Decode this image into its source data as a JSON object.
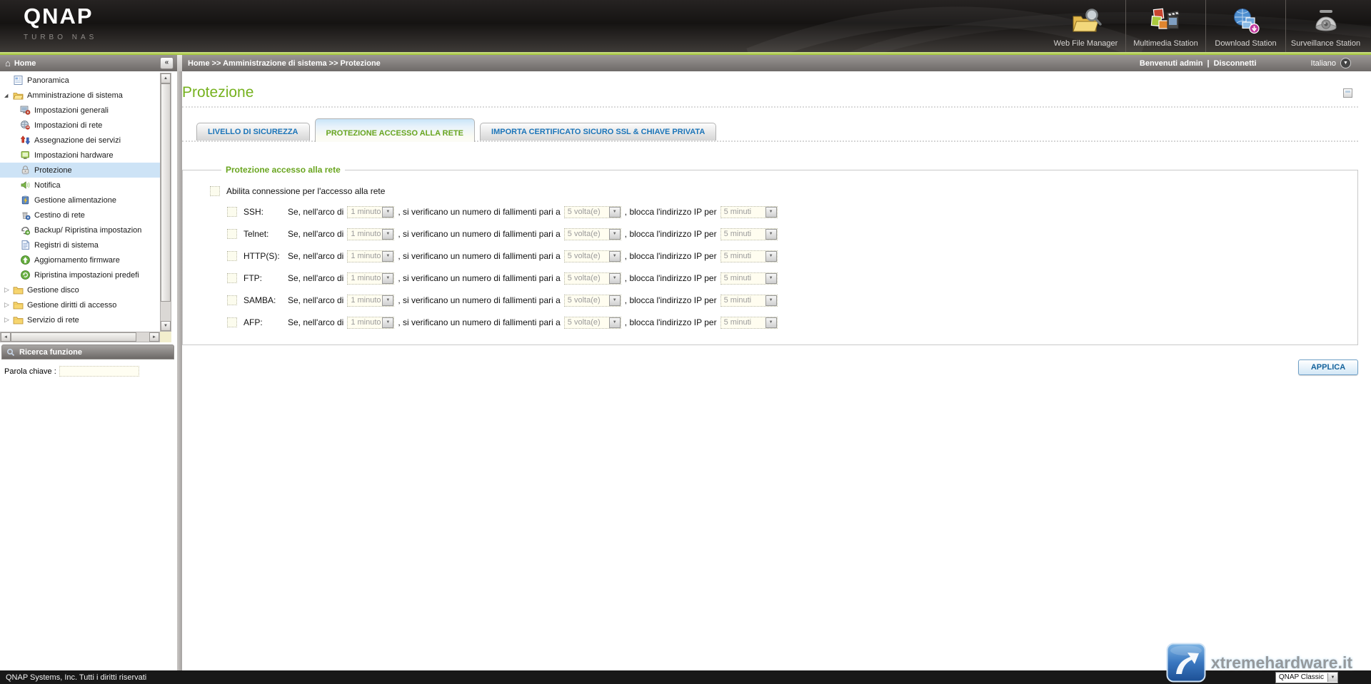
{
  "colors": {
    "accent_green": "#76b21f",
    "tab_blue": "#1b74b8",
    "selected_row_blue": "#cde3f6",
    "header_accent_line": "#9cc12f"
  },
  "header": {
    "logo_title": "QNAP",
    "logo_subtitle": "TURBO NAS",
    "stations": [
      {
        "label": "Web File Manager"
      },
      {
        "label": "Multimedia Station"
      },
      {
        "label": "Download Station"
      },
      {
        "label": "Surveillance Station"
      }
    ]
  },
  "topbar": {
    "sidebar_title": "Home",
    "breadcrumb": "Home >> Amministrazione di sistema >> Protezione",
    "welcome": "Benvenuti admin",
    "separator": "|",
    "logout": "Disconnetti",
    "language": "Italiano"
  },
  "sidebar": {
    "items": [
      {
        "label": "Panoramica"
      },
      {
        "label": "Amministrazione di sistema"
      },
      {
        "label": "Impostazioni generali"
      },
      {
        "label": "Impostazioni di rete"
      },
      {
        "label": "Assegnazione dei servizi"
      },
      {
        "label": "Impostazioni hardware"
      },
      {
        "label": "Protezione",
        "selected": true
      },
      {
        "label": "Notifica"
      },
      {
        "label": "Gestione alimentazione"
      },
      {
        "label": "Cestino di rete"
      },
      {
        "label": "Backup/ Ripristina impostazion"
      },
      {
        "label": "Registri di sistema"
      },
      {
        "label": "Aggiornamento firmware"
      },
      {
        "label": "Ripristina impostazioni predefi"
      },
      {
        "label": "Gestione disco"
      },
      {
        "label": "Gestione diritti di accesso"
      },
      {
        "label": "Servizio di rete"
      }
    ],
    "search": {
      "title": "Ricerca funzione",
      "keyword_label": "Parola chiave :",
      "keyword_value": ""
    }
  },
  "main": {
    "title": "Protezione",
    "tabs": [
      {
        "label": "LIVELLO DI SICUREZZA",
        "active": false
      },
      {
        "label": "PROTEZIONE ACCESSO ALLA RETE",
        "active": true
      },
      {
        "label": "IMPORTA CERTIFICATO SICURO SSL & CHIAVE PRIVATA",
        "active": false
      }
    ],
    "fieldset": {
      "legend": "Protezione accesso alla rete",
      "enable_label": "Abilita connessione per l'accesso alla rete",
      "row_text": {
        "part1": "Se, nell'arco di",
        "part2": ", si verificano un numero di fallimenti pari a",
        "part3": ", blocca l'indirizzo IP per"
      },
      "services": [
        {
          "name": "SSH:",
          "interval": "1 minuto",
          "failures": "5 volta(e)",
          "block": "5 minuti"
        },
        {
          "name": "Telnet:",
          "interval": "1 minuto",
          "failures": "5 volta(e)",
          "block": "5 minuti"
        },
        {
          "name": "HTTP(S):",
          "interval": "1 minuto",
          "failures": "5 volta(e)",
          "block": "5 minuti"
        },
        {
          "name": "FTP:",
          "interval": "1 minuto",
          "failures": "5 volta(e)",
          "block": "5 minuti"
        },
        {
          "name": "SAMBA:",
          "interval": "1 minuto",
          "failures": "5 volta(e)",
          "block": "5 minuti"
        },
        {
          "name": "AFP:",
          "interval": "1 minuto",
          "failures": "5 volta(e)",
          "block": "5 minuti"
        }
      ]
    },
    "apply_label": "APPLICA"
  },
  "footer": {
    "copyright": "QNAP Systems, Inc. Tutti i diritti riservati",
    "theme": "QNAP Classic"
  },
  "watermark": {
    "text": "xtremehardware.it"
  },
  "icons": {
    "collapse_glyph": "«",
    "house_glyph": "⌂",
    "language_arrow_glyph": "▼",
    "dropdown_arrow_glyph": "▼",
    "tree_expanded_glyph": "◢",
    "tree_collapsed_glyph": "▷",
    "scroll_up_glyph": "▲",
    "scroll_down_glyph": "▼",
    "scroll_left_glyph": "◄",
    "scroll_right_glyph": "►"
  }
}
